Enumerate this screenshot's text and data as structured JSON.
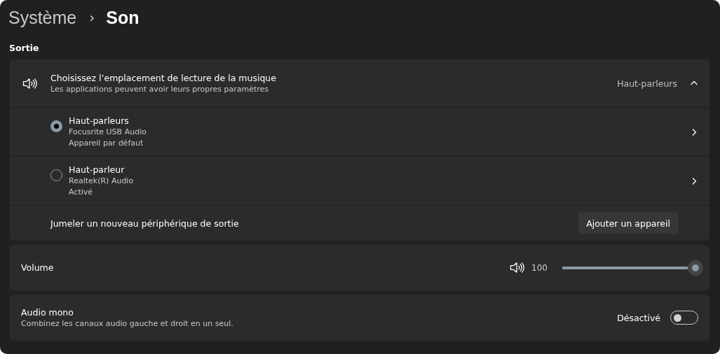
{
  "breadcrumb": {
    "parent": "Système",
    "separator": "›",
    "current": "Son"
  },
  "section_title": "Sortie",
  "output": {
    "title": "Choisissez l’emplacement de lecture de la musique",
    "subtitle": "Les applications peuvent avoir leurs propres paramètres",
    "value": "Haut-parleurs",
    "expanded": true,
    "devices": [
      {
        "name": "Haut-parleurs",
        "detail": "Focusrite USB Audio",
        "status": "Appareil par défaut",
        "selected": true
      },
      {
        "name": "Haut-parleur",
        "detail": "Realtek(R) Audio",
        "status": "Activé",
        "selected": false
      }
    ],
    "pair": {
      "label": "Jumeler un nouveau périphérique de sortie",
      "button": "Ajouter un appareil"
    }
  },
  "volume": {
    "label": "Volume",
    "reading": "100",
    "level": 1.0
  },
  "mono": {
    "title": "Audio mono",
    "subtitle": "Combinez les canaux audio gauche et droit en un seul.",
    "state_label": "Désactivé",
    "on": false
  }
}
